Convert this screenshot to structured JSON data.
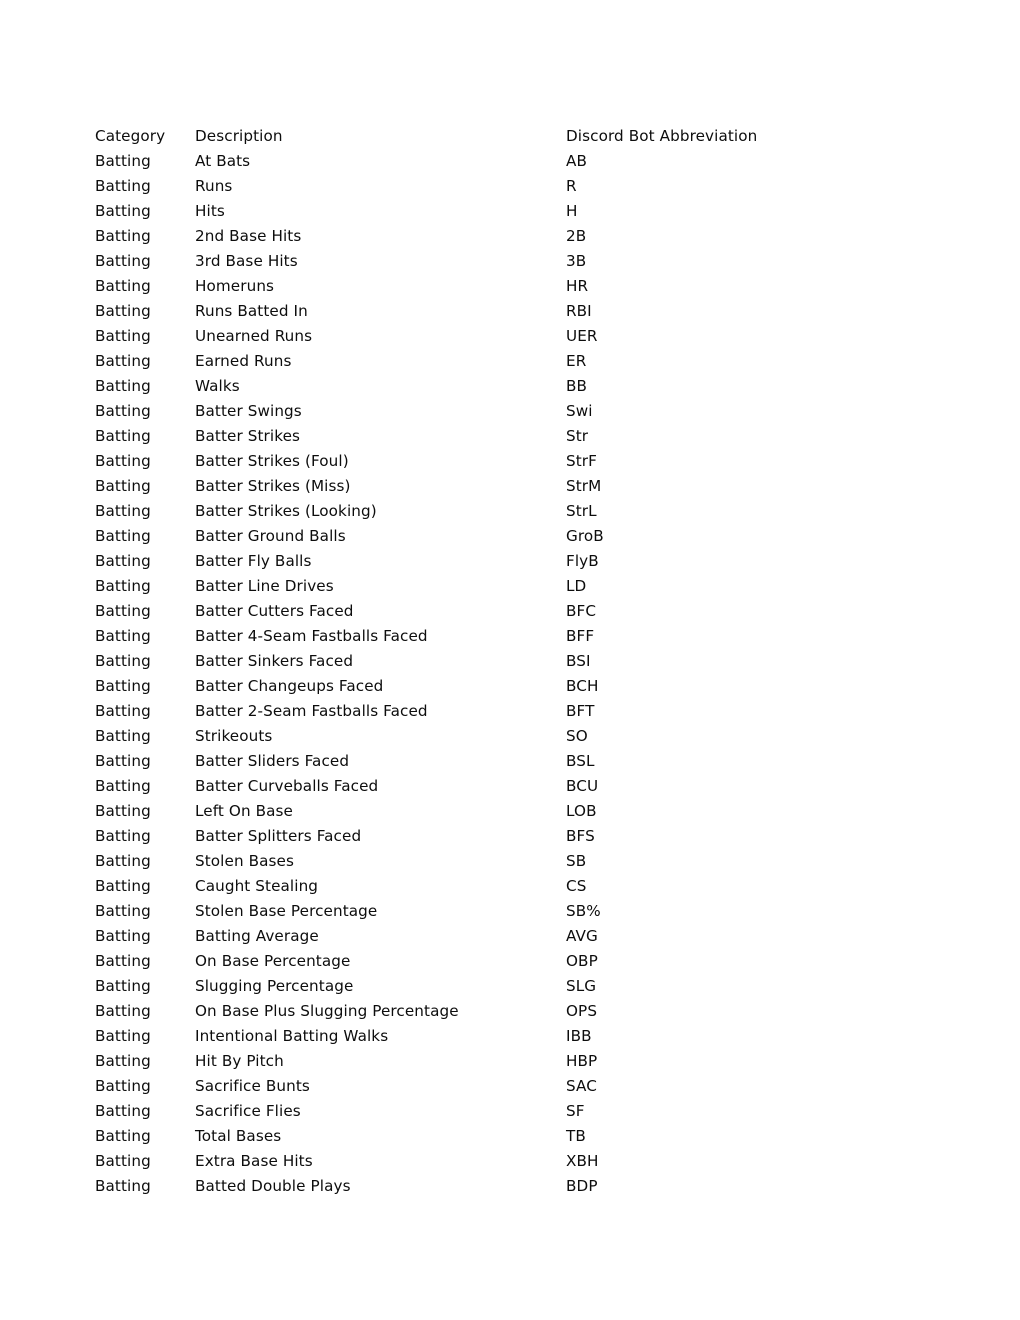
{
  "document": {
    "columns": {
      "category": "Category",
      "description": "Description",
      "abbreviation": "Discord Bot Abbreviation"
    },
    "rows": [
      {
        "category": "Batting",
        "description": "At Bats",
        "abbreviation": "AB"
      },
      {
        "category": "Batting",
        "description": "Runs",
        "abbreviation": "R"
      },
      {
        "category": "Batting",
        "description": "Hits",
        "abbreviation": "H"
      },
      {
        "category": "Batting",
        "description": "2nd Base Hits",
        "abbreviation": "2B"
      },
      {
        "category": "Batting",
        "description": "3rd Base Hits",
        "abbreviation": "3B"
      },
      {
        "category": "Batting",
        "description": "Homeruns",
        "abbreviation": "HR"
      },
      {
        "category": "Batting",
        "description": "Runs Batted In",
        "abbreviation": "RBI"
      },
      {
        "category": "Batting",
        "description": "Unearned Runs",
        "abbreviation": "UER"
      },
      {
        "category": "Batting",
        "description": "Earned Runs",
        "abbreviation": "ER"
      },
      {
        "category": "Batting",
        "description": "Walks",
        "abbreviation": "BB"
      },
      {
        "category": "Batting",
        "description": "Batter Swings",
        "abbreviation": "Swi"
      },
      {
        "category": "Batting",
        "description": "Batter Strikes",
        "abbreviation": "Str"
      },
      {
        "category": "Batting",
        "description": "Batter Strikes (Foul)",
        "abbreviation": "StrF"
      },
      {
        "category": "Batting",
        "description": "Batter Strikes (Miss)",
        "abbreviation": "StrM"
      },
      {
        "category": "Batting",
        "description": "Batter Strikes (Looking)",
        "abbreviation": "StrL"
      },
      {
        "category": "Batting",
        "description": "Batter Ground Balls",
        "abbreviation": "GroB"
      },
      {
        "category": "Batting",
        "description": "Batter Fly Balls",
        "abbreviation": "FlyB"
      },
      {
        "category": "Batting",
        "description": "Batter Line Drives",
        "abbreviation": "LD"
      },
      {
        "category": "Batting",
        "description": "Batter Cutters Faced",
        "abbreviation": "BFC"
      },
      {
        "category": "Batting",
        "description": "Batter 4-Seam Fastballs Faced",
        "abbreviation": "BFF"
      },
      {
        "category": "Batting",
        "description": "Batter Sinkers Faced",
        "abbreviation": "BSI"
      },
      {
        "category": "Batting",
        "description": "Batter Changeups Faced",
        "abbreviation": "BCH"
      },
      {
        "category": "Batting",
        "description": "Batter 2-Seam Fastballs Faced",
        "abbreviation": "BFT"
      },
      {
        "category": "Batting",
        "description": "Strikeouts",
        "abbreviation": "SO"
      },
      {
        "category": "Batting",
        "description": "Batter Sliders Faced",
        "abbreviation": "BSL"
      },
      {
        "category": "Batting",
        "description": "Batter Curveballs Faced",
        "abbreviation": "BCU"
      },
      {
        "category": "Batting",
        "description": "Left On Base",
        "abbreviation": "LOB"
      },
      {
        "category": "Batting",
        "description": "Batter Splitters Faced",
        "abbreviation": "BFS"
      },
      {
        "category": "Batting",
        "description": "Stolen Bases",
        "abbreviation": "SB"
      },
      {
        "category": "Batting",
        "description": "Caught Stealing",
        "abbreviation": "CS"
      },
      {
        "category": "Batting",
        "description": "Stolen Base Percentage",
        "abbreviation": "SB%"
      },
      {
        "category": "Batting",
        "description": "Batting Average",
        "abbreviation": "AVG"
      },
      {
        "category": "Batting",
        "description": "On Base Percentage",
        "abbreviation": "OBP"
      },
      {
        "category": "Batting",
        "description": "Slugging Percentage",
        "abbreviation": "SLG"
      },
      {
        "category": "Batting",
        "description": "On Base Plus Slugging Percentage",
        "abbreviation": "OPS"
      },
      {
        "category": "Batting",
        "description": "Intentional Batting Walks",
        "abbreviation": "IBB"
      },
      {
        "category": "Batting",
        "description": "Hit By Pitch",
        "abbreviation": "HBP"
      },
      {
        "category": "Batting",
        "description": "Sacrifice Bunts",
        "abbreviation": "SAC"
      },
      {
        "category": "Batting",
        "description": "Sacrifice Flies",
        "abbreviation": "SF"
      },
      {
        "category": "Batting",
        "description": "Total Bases",
        "abbreviation": "TB"
      },
      {
        "category": "Batting",
        "description": "Extra Base Hits",
        "abbreviation": "XBH"
      },
      {
        "category": "Batting",
        "description": "Batted Double Plays",
        "abbreviation": "BDP"
      }
    ]
  }
}
